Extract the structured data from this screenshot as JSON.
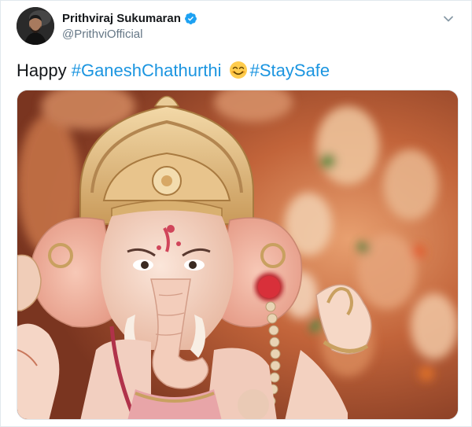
{
  "tweet": {
    "author": {
      "display_name": "Prithviraj Sukumaran",
      "handle": "@PrithviOfficial",
      "verified": true,
      "avatar_icon": "profile-photo"
    },
    "text": {
      "prefix": "Happy ",
      "hashtag_1": "#GaneshChathurthi",
      "emoji": "smiling-face-with-smiling-eyes",
      "hashtag_2": "#StaySafe"
    },
    "colors": {
      "hashtag": "#1b95e0",
      "verified_badge": "#1da1f2",
      "secondary_text": "#657786"
    },
    "more_menu_icon": "chevron-down-icon",
    "media": {
      "type": "photo"
    }
  }
}
